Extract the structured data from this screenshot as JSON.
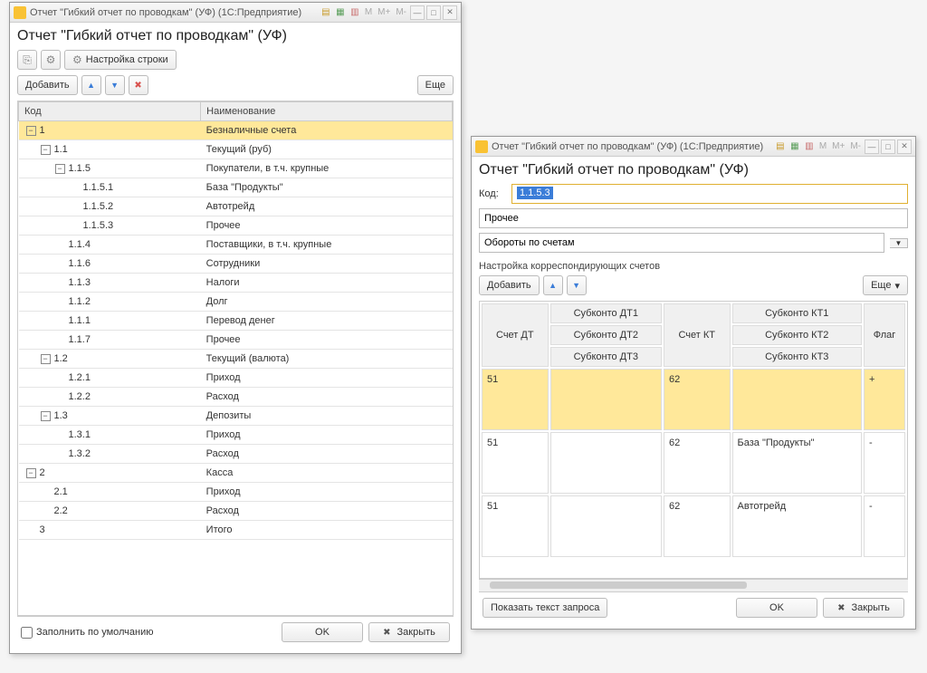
{
  "win1": {
    "titlebar": "Отчет \"Гибкий отчет по проводкам\" (УФ)  (1С:Предприятие)",
    "heading": "Отчет \"Гибкий отчет по проводкам\" (УФ)",
    "settings_btn": "Настройка строки",
    "add_btn": "Добавить",
    "more_btn": "Еще",
    "col_code": "Код",
    "col_name": "Наименование",
    "rows": [
      {
        "ind": 0,
        "tg": "−",
        "code": "1",
        "name": "Безналичные счета",
        "sel": true
      },
      {
        "ind": 1,
        "tg": "−",
        "code": "1.1",
        "name": "Текущий (руб)"
      },
      {
        "ind": 2,
        "tg": "−",
        "code": "1.1.5",
        "name": "Покупатели, в т.ч. крупные"
      },
      {
        "ind": 3,
        "tg": "",
        "code": "1.1.5.1",
        "name": "База \"Продукты\""
      },
      {
        "ind": 3,
        "tg": "",
        "code": "1.1.5.2",
        "name": "Автотрейд"
      },
      {
        "ind": 3,
        "tg": "",
        "code": "1.1.5.3",
        "name": "Прочее"
      },
      {
        "ind": 2,
        "tg": "",
        "code": "1.1.4",
        "name": "Поставщики, в т.ч. крупные"
      },
      {
        "ind": 2,
        "tg": "",
        "code": "1.1.6",
        "name": "Сотрудники"
      },
      {
        "ind": 2,
        "tg": "",
        "code": "1.1.3",
        "name": "Налоги"
      },
      {
        "ind": 2,
        "tg": "",
        "code": "1.1.2",
        "name": "Долг"
      },
      {
        "ind": 2,
        "tg": "",
        "code": "1.1.1",
        "name": "Перевод денег"
      },
      {
        "ind": 2,
        "tg": "",
        "code": "1.1.7",
        "name": "Прочее"
      },
      {
        "ind": 1,
        "tg": "−",
        "code": "1.2",
        "name": "Текущий (валюта)"
      },
      {
        "ind": 2,
        "tg": "",
        "code": "1.2.1",
        "name": "Приход"
      },
      {
        "ind": 2,
        "tg": "",
        "code": "1.2.2",
        "name": "Расход"
      },
      {
        "ind": 1,
        "tg": "−",
        "code": "1.3",
        "name": "Депозиты"
      },
      {
        "ind": 2,
        "tg": "",
        "code": "1.3.1",
        "name": "Приход"
      },
      {
        "ind": 2,
        "tg": "",
        "code": "1.3.2",
        "name": "Расход"
      },
      {
        "ind": 0,
        "tg": "−",
        "code": "2",
        "name": "Касса"
      },
      {
        "ind": 1,
        "tg": "",
        "code": "2.1",
        "name": "Приход"
      },
      {
        "ind": 1,
        "tg": "",
        "code": "2.2",
        "name": "Расход"
      },
      {
        "ind": 0,
        "tg": "",
        "code": "3",
        "name": "Итого"
      }
    ],
    "fill_default": "Заполнить по умолчанию",
    "ok_btn": "OK",
    "close_btn": "Закрыть"
  },
  "win2": {
    "titlebar": "Отчет \"Гибкий отчет по проводкам\" (УФ)  (1С:Предприятие)",
    "heading": "Отчет \"Гибкий отчет по проводкам\" (УФ)",
    "code_lbl": "Код:",
    "code_val": "1.1.5.3",
    "name_val": "Прочее",
    "mode_val": "Обороты по счетам",
    "section_label": "Настройка корреспондирующих счетов",
    "add_btn": "Добавить",
    "more_btn": "Еще",
    "headers": {
      "dt": "Счет ДТ",
      "sdt1": "Субконто ДТ1",
      "sdt2": "Субконто ДТ2",
      "sdt3": "Субконто ДТ3",
      "kt": "Счет КТ",
      "skt1": "Субконто КТ1",
      "skt2": "Субконто КТ2",
      "skt3": "Субконто КТ3",
      "flag": "Флаг"
    },
    "rows": [
      {
        "dt": "51",
        "sdt": "",
        "kt": "62",
        "skt": "",
        "flag": "+",
        "sel": true
      },
      {
        "dt": "51",
        "sdt": "",
        "kt": "62",
        "skt": "База \"Продукты\"",
        "flag": "-"
      },
      {
        "dt": "51",
        "sdt": "",
        "kt": "62",
        "skt": "Автотрейд",
        "flag": "-"
      }
    ],
    "show_query_btn": "Показать текст запроса",
    "ok_btn": "OK",
    "close_btn": "Закрыть"
  }
}
